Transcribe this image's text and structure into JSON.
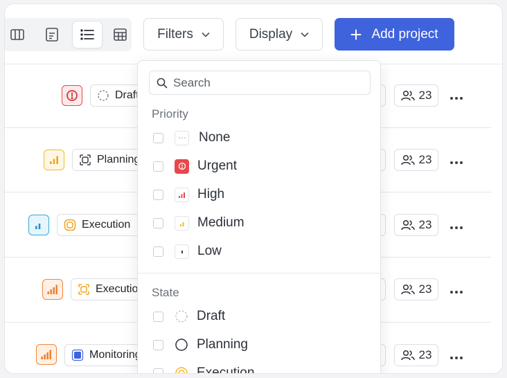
{
  "toolbar": {
    "views": [
      {
        "icon": "board-view-icon"
      },
      {
        "icon": "document-view-icon"
      },
      {
        "icon": "list-view-icon",
        "active": true
      },
      {
        "icon": "table-view-icon"
      }
    ],
    "filters_label": "Filters",
    "display_label": "Display",
    "add_project_label": "Add project",
    "accent_color": "#3f63dd"
  },
  "rows": [
    {
      "priority": "Urgent",
      "state": "Draft",
      "members": "23"
    },
    {
      "priority": "High",
      "state": "Planning",
      "members": "23"
    },
    {
      "priority": "Low",
      "state": "Execution",
      "members": "23"
    },
    {
      "priority": "High",
      "state": "Execution",
      "members": "23"
    },
    {
      "priority": "High",
      "state": "Monitoring",
      "members": "23"
    }
  ],
  "filters_dropdown": {
    "search_placeholder": "Search",
    "priority_title": "Priority",
    "priority_options": [
      "None",
      "Urgent",
      "High",
      "Medium",
      "Low"
    ],
    "state_title": "State",
    "state_options": [
      "Draft",
      "Planning",
      "Execution"
    ]
  },
  "colors": {
    "urgent": "#e5484d",
    "high": "#f0863a",
    "medium": "#f5b731",
    "low": "#3aa7d6",
    "execution": "#f5b731",
    "monitoring": "#3f63dd"
  }
}
